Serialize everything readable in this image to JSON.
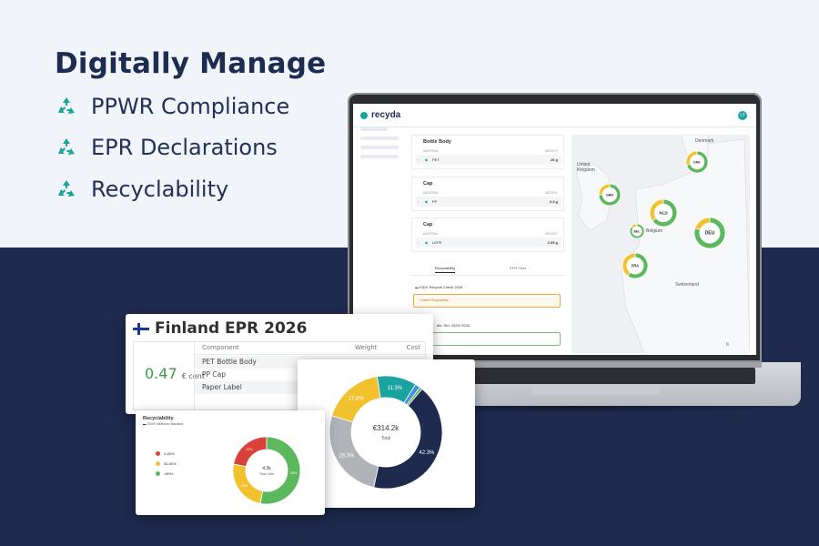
{
  "colors": {
    "navy": "#1e2b4e",
    "teal": "#1aa4a0",
    "green": "#5cb85c",
    "yellow": "#f2c12e",
    "red": "#d9413a",
    "gray": "#b0b3b8"
  },
  "hero": {
    "headline": "Digitally Manage",
    "features": [
      {
        "icon": "recycle-icon",
        "label": "PPWR Compliance"
      },
      {
        "icon": "recycle-icon",
        "label": "EPR Declarations"
      },
      {
        "icon": "recycle-icon",
        "label": "Recyclability"
      }
    ]
  },
  "app": {
    "logo": "recyda",
    "user_initials": "LT",
    "components": [
      {
        "title": "Bottle Body",
        "material_hdr": "MATERIAL",
        "weight_hdr": "WEIGHT",
        "material": "PET",
        "weight": "26 g"
      },
      {
        "title": "Cap",
        "material_hdr": "MATERIAL",
        "weight_hdr": "WEIGHT",
        "material": "PP",
        "weight": "2.3 g"
      },
      {
        "title": "Cap",
        "material_hdr": "MATERIAL",
        "weight_hdr": "WEIGHT",
        "material": "LDPE",
        "weight": "2.65 g"
      }
    ],
    "tabs": [
      "Recyclability",
      "EPR Fees"
    ],
    "check_title": "KIDV Recycle Check 2025",
    "check_status": "Limited Recyclability",
    "standard_title": "die. Std. 2025+2026",
    "map": {
      "labels": [
        "Denmark",
        "United Kingdom",
        "Belgium",
        "Switzerland",
        "It"
      ],
      "markers": [
        "DNK",
        "GBR",
        "NLD",
        "BEL",
        "DEU",
        "FRA"
      ]
    }
  },
  "finland": {
    "title": "Finland EPR 2026",
    "price_value": "0.47",
    "price_unit": "€ cent",
    "headers": {
      "component": "Component",
      "weight": "Weight",
      "cost": "Cost"
    },
    "rows": [
      "PET Bottle Body",
      "PP Cap",
      "Paper Label"
    ]
  },
  "total_chart": {
    "center_value": "€314.2k",
    "center_label": "Total"
  },
  "recyclability": {
    "title": "Recyclability",
    "subtitle": "ZSVR Minimum Standard",
    "legend": [
      "0-50%",
      "50-80%",
      ">80%"
    ],
    "center_value": "4.3k",
    "center_label": "Total Units"
  },
  "chart_data": [
    {
      "type": "pie",
      "title": "",
      "categories": [
        "Navy",
        "Gray",
        "Yellow",
        "Teal",
        "Blue",
        "Green"
      ],
      "values": [
        42.3,
        26.3,
        17.8,
        11.3,
        1.5,
        0.8
      ],
      "data_labels": [
        "42.3%",
        "26.3%",
        "17.8%",
        "11.3%"
      ]
    },
    {
      "type": "pie",
      "title": "Recyclability",
      "categories": [
        ">80%",
        "50-80%",
        "0-50%"
      ],
      "values": [
        53,
        25,
        22
      ],
      "data_labels": [
        "53%",
        "25%",
        "22%"
      ]
    }
  ]
}
